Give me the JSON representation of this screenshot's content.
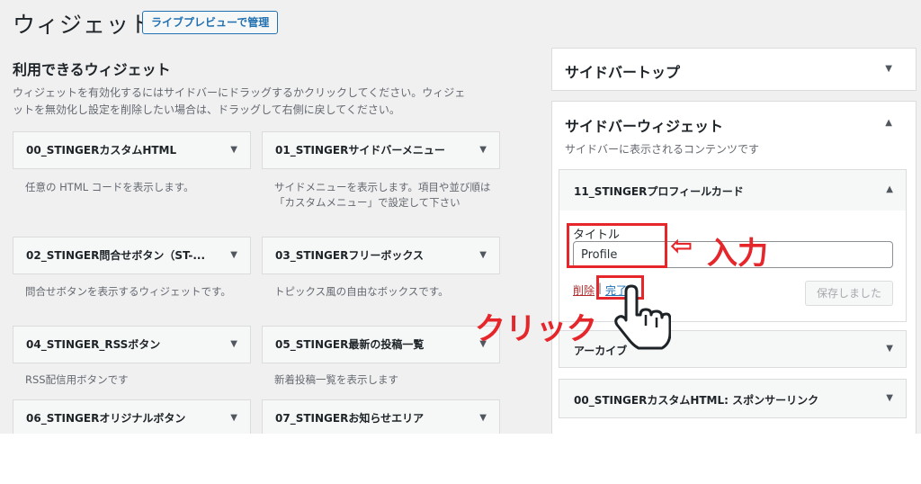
{
  "header": {
    "title": "ウィジェット",
    "manage_button": "ライブプレビューで管理"
  },
  "available": {
    "title": "利用できるウィジェット",
    "description": "ウィジェットを有効化するにはサイドバーにドラッグするかクリックしてください。ウィジェットを無効化し設定を削除したい場合は、ドラッグして右側に戻してください。"
  },
  "widgets": [
    {
      "name": "00_STINGERカスタムHTML",
      "desc": "任意の HTML コードを表示します。"
    },
    {
      "name": "01_STINGERサイドバーメニュー",
      "desc": "サイドメニューを表示します。項目や並び順は「カスタムメニュー」で設定して下さい"
    },
    {
      "name": "02_STINGER問合せボタン（ST-...",
      "desc": "問合せボタンを表示するウィジェットです。"
    },
    {
      "name": "03_STINGERフリーボックス",
      "desc": "トピックス風の自由なボックスです。"
    },
    {
      "name": "04_STINGER_RSSボタン",
      "desc": "RSS配信用ボタンです"
    },
    {
      "name": "05_STINGER最新の投稿一覧",
      "desc": "新着投稿一覧を表示します"
    },
    {
      "name": "06_STINGERオリジナルボタン",
      "desc": ""
    },
    {
      "name": "07_STINGERお知らせエリア",
      "desc": ""
    }
  ],
  "sidebar_top": {
    "title": "サイドバートップ"
  },
  "sidebar_widget": {
    "title": "サイドバーウィジェット",
    "description": "サイドバーに表示されるコンテンツです",
    "open_widget": {
      "title": "11_STINGERプロフィールカード",
      "field_label": "タイトル",
      "field_value": "Profile",
      "delete_link": "削除",
      "separator": "|",
      "done_link": "完了",
      "save_button": "保存しました"
    },
    "other_widgets": [
      "アーカイブ",
      "00_STINGERカスタムHTML: スポンサーリンク"
    ]
  },
  "annotations": {
    "input_label": "入力",
    "input_arrow": "⇦",
    "click_label": "クリック",
    "color": "#e5262b"
  },
  "colors": {
    "accent": "#2271b1",
    "background": "#f0f0f1",
    "delete": "#b32d2e"
  }
}
